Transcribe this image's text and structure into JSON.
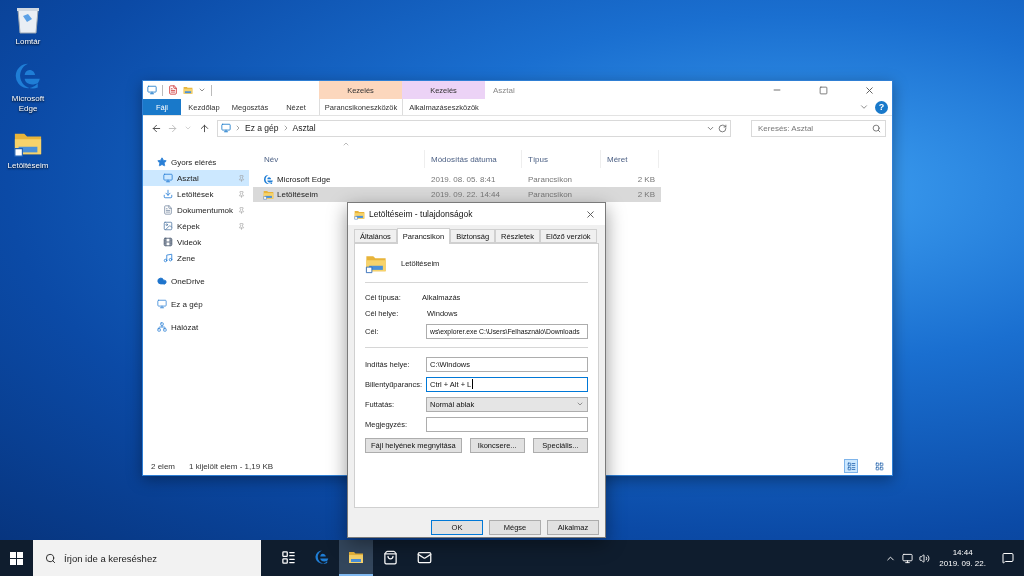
{
  "desktop": {
    "icons": [
      {
        "label": "Lomtár",
        "kind": "recycle"
      },
      {
        "label": "Microsoft Edge",
        "kind": "edge"
      },
      {
        "label": "Letöltéseim",
        "kind": "folder"
      }
    ]
  },
  "explorer": {
    "title": "Asztal",
    "context_tabs": [
      {
        "label": "Kezelés",
        "color": "#fcd7bd"
      },
      {
        "label": "Kezelés",
        "color": "#ecd3f6"
      }
    ],
    "ribbon_tabs": [
      {
        "label": "Fájl",
        "kind": "file"
      },
      {
        "label": "Kezdőlap",
        "kind": "tab"
      },
      {
        "label": "Megosztás",
        "kind": "tab"
      },
      {
        "label": "Nézet",
        "kind": "tab"
      },
      {
        "label": "Parancsikoneszközök",
        "kind": "context"
      },
      {
        "label": "Alkalmazáseszközök",
        "kind": "context"
      }
    ],
    "help_button": "?",
    "crumbs": [
      "Ez a gép",
      "Asztal"
    ],
    "search": {
      "placeholder": "Keresés: Asztal"
    },
    "nav": [
      {
        "label": "Gyors elérés",
        "kind": "star",
        "selected": false,
        "children": [
          {
            "label": "Asztal",
            "kind": "desktop",
            "selected": true,
            "pinned": true
          },
          {
            "label": "Letöltések",
            "kind": "download",
            "selected": false,
            "pinned": true
          },
          {
            "label": "Dokumentumok",
            "kind": "documents",
            "selected": false,
            "pinned": true
          },
          {
            "label": "Képek",
            "kind": "pictures",
            "selected": false,
            "pinned": true
          },
          {
            "label": "Videók",
            "kind": "videos",
            "selected": false,
            "pinned": false
          },
          {
            "label": "Zene",
            "kind": "music",
            "selected": false,
            "pinned": false
          }
        ]
      },
      {
        "label": "OneDrive",
        "kind": "cloud",
        "selected": false
      },
      {
        "label": "Ez a gép",
        "kind": "pc",
        "selected": false
      },
      {
        "label": "Hálózat",
        "kind": "network",
        "selected": false
      }
    ],
    "columns": [
      "Név",
      "Módosítás dátuma",
      "Típus",
      "Méret"
    ],
    "rows": [
      {
        "name": "Microsoft Edge",
        "date": "2019. 08. 05. 8:41",
        "type": "Parancsikon",
        "size": "2 KB",
        "kind": "edge",
        "selected": false
      },
      {
        "name": "Letöltéseim",
        "date": "2019. 09. 22. 14:44",
        "type": "Parancsikon",
        "size": "2 KB",
        "kind": "folder",
        "selected": true
      }
    ],
    "status": {
      "count": "2 elem",
      "selection": "1 kijelölt elem - 1,19 KB"
    }
  },
  "dialog": {
    "title": "Letöltéseim - tulajdonságok",
    "tabs": [
      {
        "label": "Általános",
        "selected": false
      },
      {
        "label": "Parancsikon",
        "selected": true
      },
      {
        "label": "Biztonság",
        "selected": false
      },
      {
        "label": "Részletek",
        "selected": false
      },
      {
        "label": "Előző verziók",
        "selected": false
      }
    ],
    "name": "Letöltéseim",
    "info": [
      {
        "label": "Cél típusa:",
        "value": "Alkalmazás"
      },
      {
        "label": "Cél helye:",
        "value": "Windows"
      }
    ],
    "target": {
      "label": "Cél:",
      "value": "ws\\explorer.exe C:\\Users\\Felhasználó\\Downloads"
    },
    "fields": [
      {
        "label": "Indítás helye:",
        "kind": "text",
        "value": "C:\\Windows"
      },
      {
        "label": "Billentyűparancs:",
        "kind": "text",
        "value": "Ctrl + Alt + L",
        "focused": true
      },
      {
        "label": "Futtatás:",
        "kind": "select",
        "value": "Normál ablak"
      },
      {
        "label": "Megjegyzés:",
        "kind": "text"
      }
    ],
    "actions": [
      "Fájl helyének megnyitása",
      "Ikoncsere...",
      "Speciális..."
    ],
    "buttons": [
      {
        "label": "OK",
        "default": true
      },
      {
        "label": "Mégse",
        "default": false
      },
      {
        "label": "Alkalmaz",
        "default": false
      }
    ]
  },
  "taskbar": {
    "search": {
      "placeholder": "Írjon ide a kereséshez"
    },
    "apps": [
      {
        "kind": "taskview",
        "active": false
      },
      {
        "kind": "edge",
        "active": false
      },
      {
        "kind": "folder",
        "active": true
      },
      {
        "kind": "store",
        "active": false
      },
      {
        "kind": "mail",
        "active": false
      }
    ],
    "time": "14:44",
    "date": "2019. 09. 22."
  }
}
